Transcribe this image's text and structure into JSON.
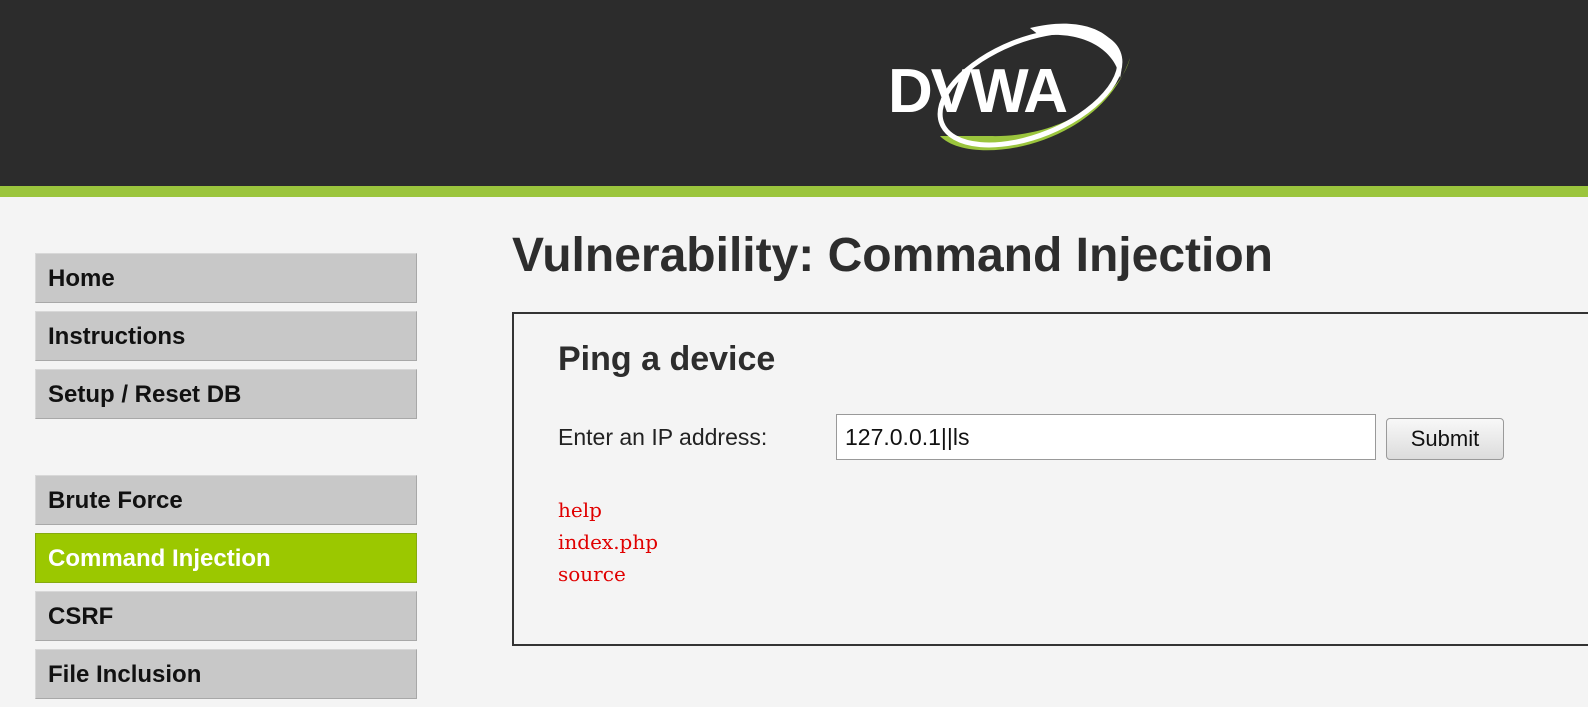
{
  "header": {
    "logo_text": "DVWA",
    "accent_color": "#9bc53d",
    "background_color": "#2c2c2c"
  },
  "menu": {
    "items_top": [
      {
        "label": "Home"
      },
      {
        "label": "Instructions"
      },
      {
        "label": "Setup / Reset DB"
      }
    ],
    "items_vulns": [
      {
        "label": "Brute Force",
        "selected": false
      },
      {
        "label": "Command Injection",
        "selected": true
      },
      {
        "label": "CSRF",
        "selected": false
      },
      {
        "label": "File Inclusion",
        "selected": false
      }
    ]
  },
  "main": {
    "title": "Vulnerability: Command Injection",
    "box": {
      "heading": "Ping a device",
      "ip_label": "Enter an IP address:",
      "ip_value": "127.0.0.1||ls",
      "submit_label": "Submit",
      "output_lines": [
        "help",
        "index.php",
        "source"
      ]
    }
  }
}
